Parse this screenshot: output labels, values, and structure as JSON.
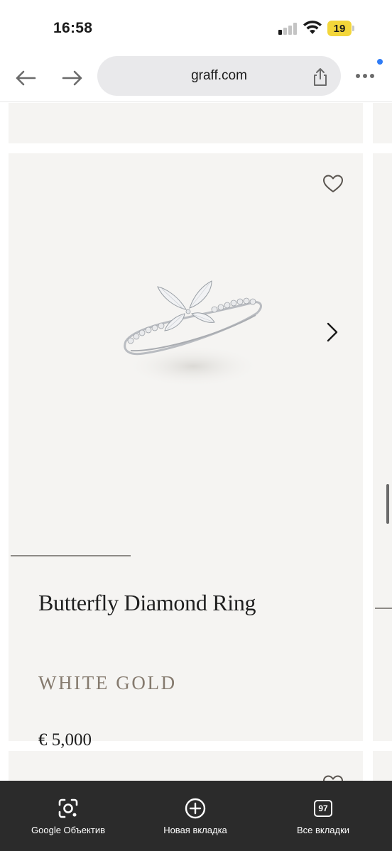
{
  "status_bar": {
    "time": "16:58",
    "battery_level": "19",
    "battery_color": "#f3d63a",
    "icons": [
      "signal-icon",
      "wifi-icon",
      "battery-icon"
    ]
  },
  "browser": {
    "url": "graff.com",
    "icons": [
      "back-arrow-icon",
      "forward-arrow-icon",
      "share-icon",
      "more-dots-icon"
    ],
    "accent": "#2f7cf6"
  },
  "product": {
    "name": "Butterfly Diamond Ring",
    "metal": "WHITE GOLD",
    "price": "€ 5,000",
    "image_progress": 0.34,
    "icons": [
      "heart-icon",
      "chevron-right-icon"
    ],
    "card_background": "#f5f4f2",
    "metal_color": "#857a6e"
  },
  "bottom_bar": {
    "items": [
      {
        "label": "Google Объектив",
        "icon": "google-lens-icon"
      },
      {
        "label": "Новая вкладка",
        "icon": "plus-circle-icon"
      },
      {
        "label": "Все вкладки",
        "icon": "tabs-count-icon",
        "count": "97"
      }
    ]
  }
}
